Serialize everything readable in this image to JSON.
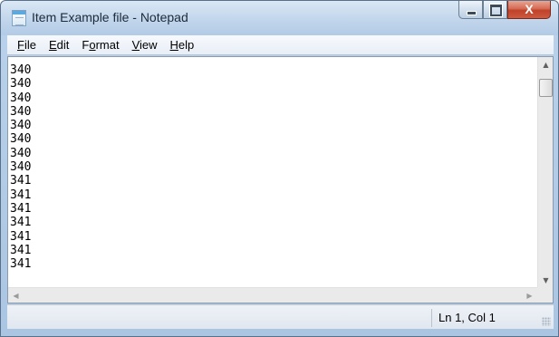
{
  "window": {
    "title": "Item Example file - Notepad",
    "close_glyph": "X"
  },
  "menu": [
    {
      "first": "F",
      "rest": "ile"
    },
    {
      "first": "E",
      "rest": "dit"
    },
    {
      "first": "F",
      "rest": "o",
      "underline_index": 1,
      "pre": "F",
      "ul": "o",
      "post": "rmat"
    },
    {
      "first": "V",
      "rest": "iew"
    },
    {
      "first": "H",
      "rest": "elp"
    }
  ],
  "editor": {
    "lines": [
      "340",
      "340",
      "340",
      "340",
      "340",
      "340",
      "340",
      "340",
      "341",
      "341",
      "341",
      "341",
      "341",
      "341",
      "341"
    ]
  },
  "statusbar": {
    "position": "Ln 1, Col 1"
  },
  "icons": {
    "app": "notepad-icon",
    "minimize": "minimize-icon",
    "maximize": "maximize-icon",
    "close": "close-icon"
  },
  "colors": {
    "titlebar": "#c3d7ec",
    "close_button": "#c0412a"
  }
}
